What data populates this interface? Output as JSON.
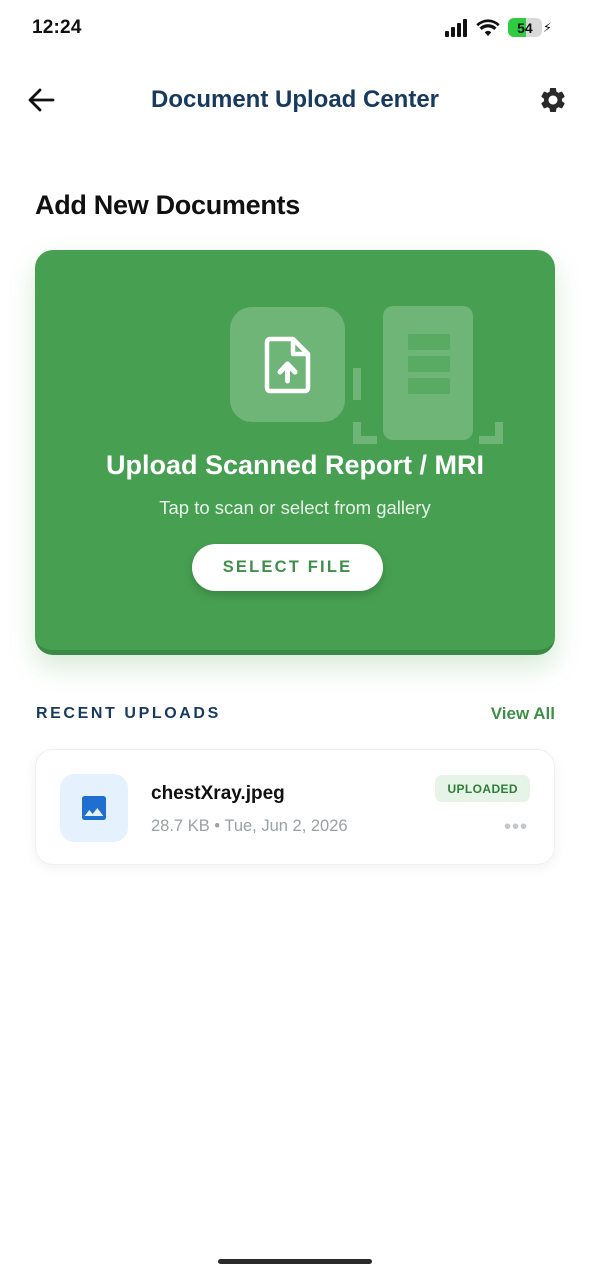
{
  "status_bar": {
    "time": "12:24",
    "battery_percent": "54",
    "battery_level": 0.54,
    "icons": [
      "signal-icon",
      "wifi-icon",
      "battery-icon",
      "charging-bolt-icon"
    ]
  },
  "header": {
    "title": "Document Upload Center",
    "back_icon": "back-arrow-icon",
    "settings_icon": "gear-icon"
  },
  "add_section": {
    "title": "Add New Documents"
  },
  "upload_card": {
    "title": "Upload Scanned Report / MRI",
    "subtitle": "Tap to scan or select from gallery",
    "button_label": "SELECT FILE",
    "icon": "file-upload-icon",
    "decoration_icon": "document-scan-icon",
    "color": "#47a052"
  },
  "recent_uploads": {
    "label": "RECENT UPLOADS",
    "view_all": "View All",
    "items": [
      {
        "name": "chestXray.jpeg",
        "meta": "28.7 KB • Tue, Jun 2, 2026",
        "status": "UPLOADED",
        "icon": "image-icon",
        "status_color": "#2f7d3a"
      }
    ]
  },
  "colors": {
    "primary_green": "#47a052",
    "navy": "#173a5e",
    "file_icon_blue": "#1e6fd0"
  }
}
